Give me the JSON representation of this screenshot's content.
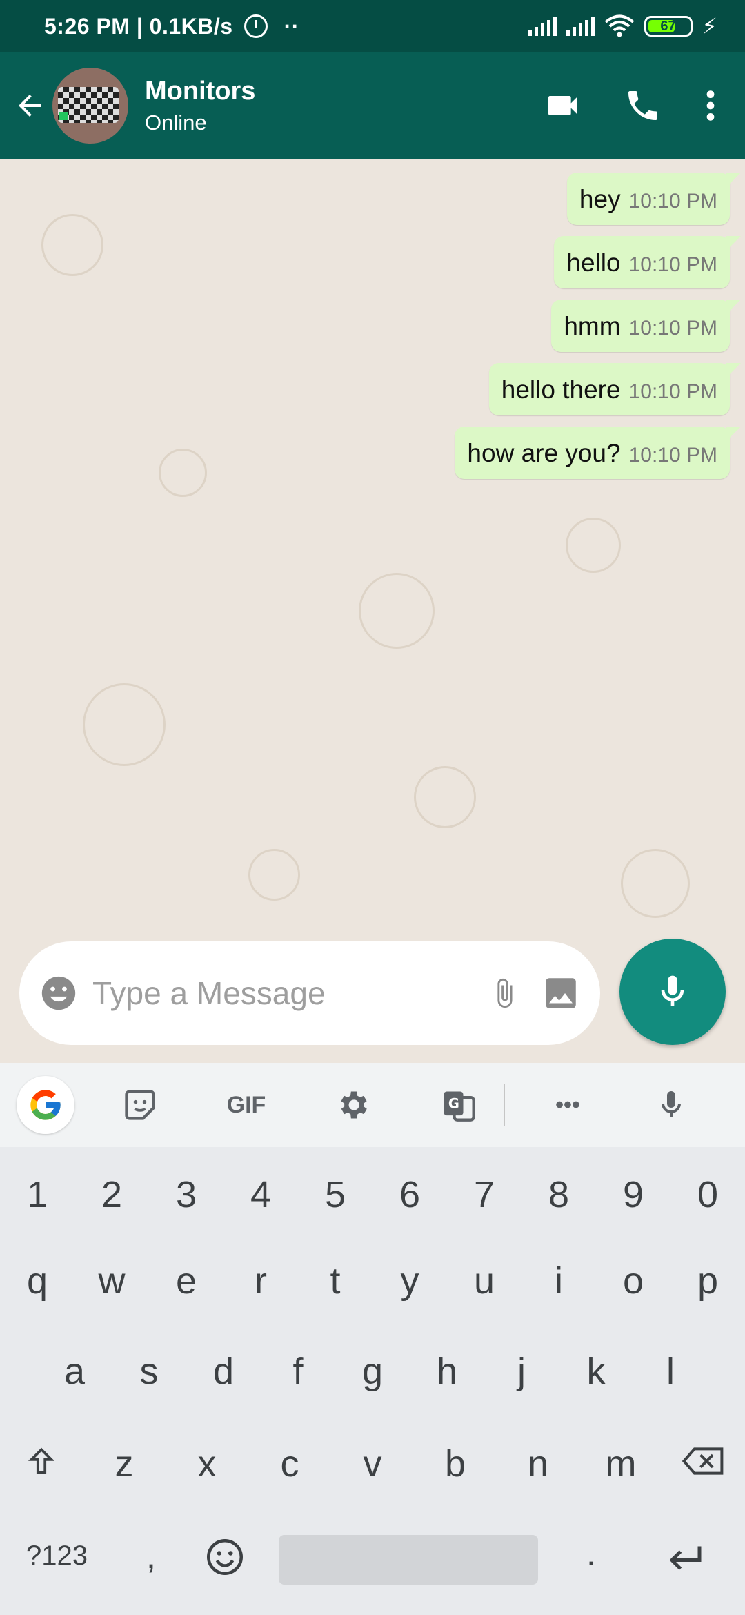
{
  "status_bar": {
    "time_speed": "5:26 PM | 0.1KB/s",
    "dots": "··",
    "battery": "67",
    "charging_glyph": "⚡"
  },
  "header": {
    "contact_name": "Monitors",
    "contact_status": "Online"
  },
  "messages": [
    {
      "text": "hey",
      "time": "10:10 PM"
    },
    {
      "text": "hello",
      "time": "10:10 PM"
    },
    {
      "text": "hmm",
      "time": "10:10 PM"
    },
    {
      "text": "hello there",
      "time": "10:10 PM"
    },
    {
      "text": "how are you?",
      "time": "10:10 PM"
    }
  ],
  "composer": {
    "placeholder": "Type a Message"
  },
  "keyboard": {
    "toolbar": {
      "gif": "GIF",
      "more": "•••"
    },
    "rows": {
      "numbers": [
        "1",
        "2",
        "3",
        "4",
        "5",
        "6",
        "7",
        "8",
        "9",
        "0"
      ],
      "row1": [
        "q",
        "w",
        "e",
        "r",
        "t",
        "y",
        "u",
        "i",
        "o",
        "p"
      ],
      "row2": [
        "a",
        "s",
        "d",
        "f",
        "g",
        "h",
        "j",
        "k",
        "l"
      ],
      "row3": [
        "z",
        "x",
        "c",
        "v",
        "b",
        "n",
        "m"
      ]
    },
    "symbols_key": "?123",
    "comma_key": ",",
    "period_key": "."
  },
  "colors": {
    "status_bar": "#054d44",
    "app_bar": "#075e54",
    "outgoing_bubble": "#dcf8c6",
    "fab": "#128c7e"
  }
}
